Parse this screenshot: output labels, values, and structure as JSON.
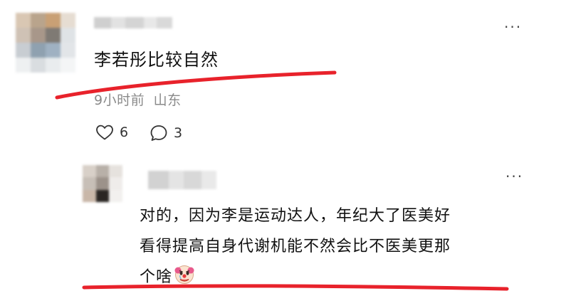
{
  "comment": {
    "text": "李若彤比较自然",
    "time": "9小时前",
    "location": "山东",
    "like_count": "6",
    "reply_count": "3",
    "more_icon": "···"
  },
  "reply": {
    "lines": [
      "对的，因为李是运动达人，年纪大了医美好",
      "看得提高自身代谢机能不然会比不医美更那",
      "个啥"
    ],
    "emoji": "clown-face",
    "more_icon": "···"
  },
  "colors": {
    "underline": "#e8222b",
    "meta_text": "#8a8a8a",
    "avatar_main": [
      "#d9c7b3",
      "#b9a48c",
      "#c9a075",
      "#e6ddd2",
      "#cfc2b5",
      "#a8978a",
      "#7f7a74",
      "#dfe3e6",
      "#c8cdd2",
      "#8fa1b0",
      "#9fb1c2",
      "#e2e5e8",
      "#eef0f1",
      "#d9dde0",
      "#e9ecee",
      "#f4f5f6"
    ],
    "avatar_reply": [
      "#d8d0c8",
      "#b8b0a8",
      "#e6e2de",
      "#c7bfb7",
      "#9c928a",
      "#efecea",
      "#c9b7a8",
      "#2a2623",
      "#f2f0ee"
    ]
  }
}
